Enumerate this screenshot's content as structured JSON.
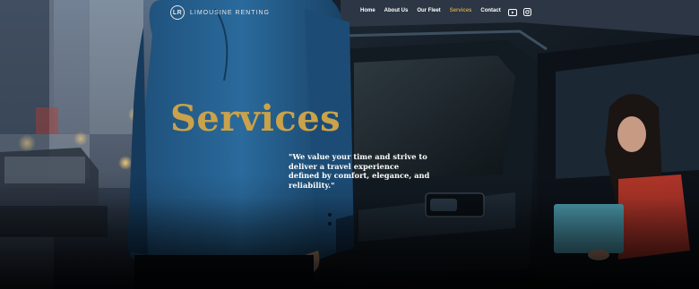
{
  "brand": {
    "logo_mark": "LR",
    "name": "LIMOUSINE RENTING"
  },
  "nav": {
    "items": [
      {
        "label": "Home",
        "active": false
      },
      {
        "label": "About Us",
        "active": false
      },
      {
        "label": "Our Fleet",
        "active": false
      },
      {
        "label": "Services",
        "active": true
      },
      {
        "label": "Contact",
        "active": false
      }
    ],
    "social": [
      {
        "icon": "youtube-icon"
      },
      {
        "icon": "instagram-icon"
      }
    ]
  },
  "hero": {
    "title": "Services",
    "quote": "\"We value your time and strive to deliver a travel experience defined by comfort, elegance, and reliability.\""
  },
  "colors": {
    "accent": "#c9a24a",
    "text": "#ffffff",
    "background": "#0b0d10"
  }
}
